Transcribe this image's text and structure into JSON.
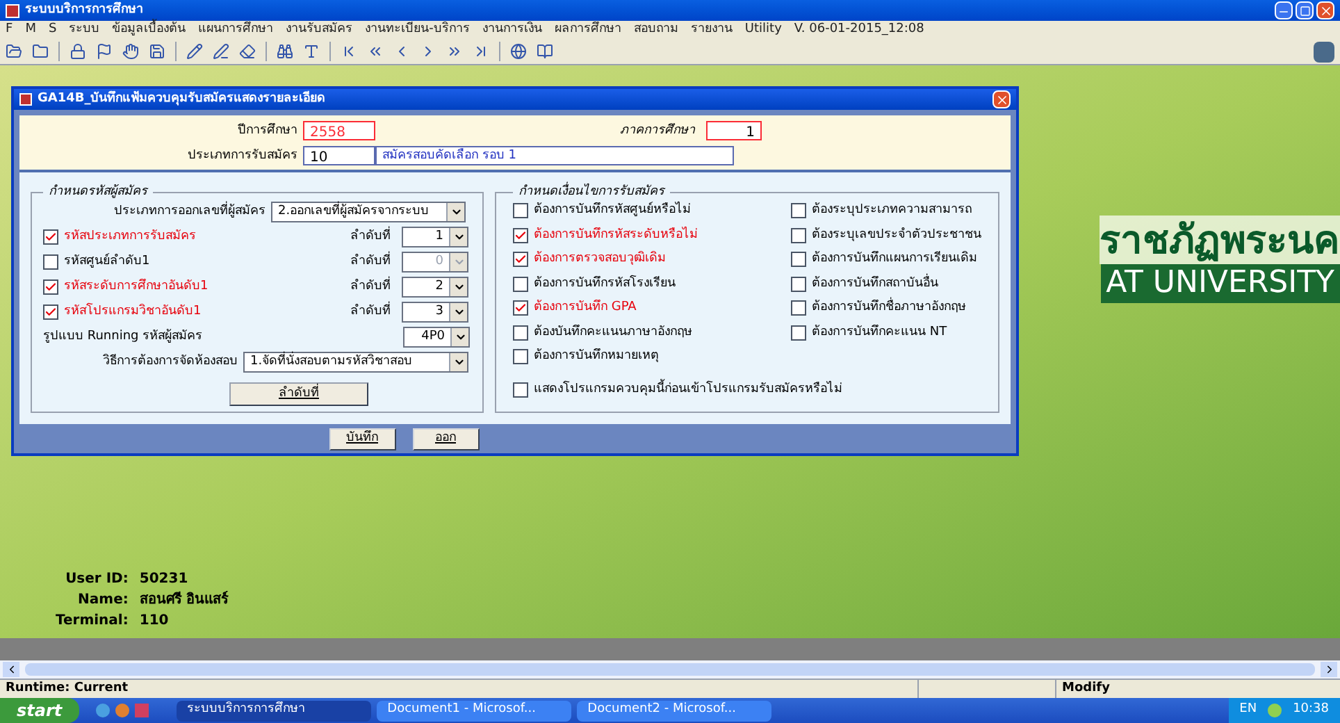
{
  "window": {
    "title": "ระบบบริการการศึกษา"
  },
  "menu": {
    "items": [
      "F",
      "M",
      "S",
      "ระบบ",
      "ข้อมูลเบื้องต้น",
      "แผนการศึกษา",
      "งานรับสมัคร",
      "งานทะเบียน-บริการ",
      "งานการเงิน",
      "ผลการศึกษา",
      "สอบถาม",
      "รายงาน",
      "Utility"
    ],
    "version": "V. 06-01-2015_12:08"
  },
  "background": {
    "banner_line_1": "ราชภัฏพระนค",
    "banner_line_2": "AT UNIVERSITY",
    "user_info": [
      {
        "label": "User ID:",
        "value": "50231"
      },
      {
        "label": "Name:",
        "value": "สอนศรี อินแสร์"
      },
      {
        "label": "Terminal:",
        "value": "110"
      }
    ]
  },
  "dialog": {
    "title": "GA14B_บันทึกแฟ้มควบคุมรับสมัครแสดงรายละเอียด",
    "header": {
      "year_label": "ปีการศึกษา",
      "year": "2558",
      "term_label": "ภาคการศึกษา",
      "term": "1",
      "type_label": "ประเภทการรับสมัคร",
      "type_code": "10",
      "type_name": "สมัครสอบคัดเลือก รอบ 1"
    },
    "code_group": {
      "title": "กำหนดรหัสผู้สมัคร",
      "issue_label": "ประเภทการออกเลขที่ผู้สมัคร",
      "issue_value": "2.ออกเลขที่ผู้สมัครจากระบบ",
      "rows": [
        {
          "label": "รหัสประเภทการรับสมัคร",
          "checked": true,
          "order_label": "ลำดับที่",
          "order": "1",
          "disabled": false
        },
        {
          "label": "รหัสศูนย์ลำดับ1",
          "checked": false,
          "order_label": "ลำดับที่",
          "order": "0",
          "disabled": true
        },
        {
          "label": "รหัสระดับการศึกษาอันดับ1",
          "checked": true,
          "order_label": "ลำดับที่",
          "order": "2",
          "disabled": false
        },
        {
          "label": "รหัสโปรแกรมวิชาอันดับ1",
          "checked": true,
          "order_label": "ลำดับที่",
          "order": "3",
          "disabled": false
        }
      ],
      "running_label": "รูปแบบ Running รหัสผู้สมัคร",
      "running_value": "4P0",
      "room_label": "วิธีการต้องการจัดห้องสอบ",
      "room_value": "1.จัดที่นั่งสอบตามรหัสวิชาสอบ",
      "order_button": "ลำดับที่"
    },
    "conditions": {
      "title": "กำหนดเงื่อนไขการรับสมัคร",
      "left": [
        {
          "label": "ต้องการบันทึกรหัสศูนย์หรือไม่",
          "checked": false
        },
        {
          "label": "ต้องการบันทึกรหัสระดับหรือไม่",
          "checked": true
        },
        {
          "label": "ต้องการตรวจสอบวุฒิเดิม",
          "checked": true
        },
        {
          "label": "ต้องการบันทึกรหัสโรงเรียน",
          "checked": false
        },
        {
          "label": "ต้องการบันทึก GPA",
          "checked": true
        },
        {
          "label": "ต้องบันทึกคะแนนภาษาอังกฤษ",
          "checked": false
        },
        {
          "label": "ต้องการบันทึกหมายเหตุ",
          "checked": false
        }
      ],
      "right": [
        {
          "label": "ต้องระบุประเภทความสามารถ",
          "checked": false
        },
        {
          "label": "ต้องระบุเลขประจำตัวประชาชน",
          "checked": false
        },
        {
          "label": "ต้องการบันทึกแผนการเรียนเดิม",
          "checked": false
        },
        {
          "label": "ต้องการบันทึกสถาบันอื่น",
          "checked": false
        },
        {
          "label": "ต้องการบันทึกชื่อภาษาอังกฤษ",
          "checked": false
        },
        {
          "label": "ต้องการบันทึกคะแนน NT",
          "checked": false
        }
      ],
      "bottom": {
        "label": "แสดงโปรแกรมควบคุมนี้ก่อนเข้าโปรแกรมรับสมัครหรือไม่",
        "checked": false
      }
    },
    "buttons": [
      "บันทึก",
      "ออก"
    ]
  },
  "status_bar": {
    "left": "Runtime: Current",
    "mode": "Modify"
  },
  "taskbar": {
    "start": "start",
    "tasks": [
      {
        "label": "ระบบบริการการศึกษา",
        "selected": true
      },
      {
        "label": "Document1 - Microsof...",
        "selected": false
      },
      {
        "label": "Document2 - Microsof...",
        "selected": false
      }
    ],
    "language": "EN",
    "clock": "10:38"
  }
}
